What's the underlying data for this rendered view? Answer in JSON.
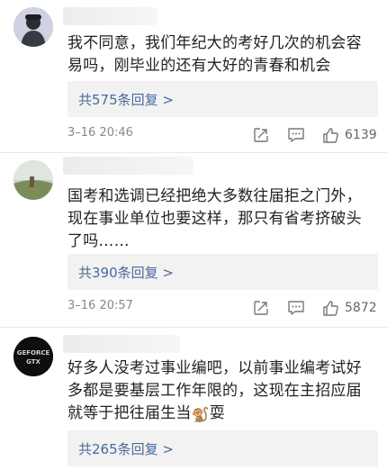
{
  "comments": [
    {
      "text": "我不同意，我们年纪大的考好几次的机会容易吗，刚毕业的还有大好的青春和机会",
      "line1": "我不同意，我们年纪大的考好几次的机会容",
      "line2": "易吗，刚毕业的还有大好的青春和机会",
      "replies": "共575条回复 >",
      "time": "3–16 20:46",
      "likes": "6139"
    },
    {
      "text": "国考和选调已经把绝大多数往届拒之门外，现在事业单位也要这样，那只有省考挤破头了吗……",
      "line1": "国考和选调已经把绝大多数往届拒之门外，",
      "line2": "现在事业单位也要这样，那只有省考挤破头",
      "line3": "了吗……",
      "replies": "共390条回复 >",
      "time": "3–16 20:57",
      "likes": "5872"
    },
    {
      "text": "好多人没考过事业编吧，以前事业编考试好多都是要基层工作年限的，这现在主招应届就等于把往届生当🐒耍",
      "line1": "好多人没考过事业编吧，以前事业编考试好",
      "line2": "多都是要基层工作年限的，这现在主招应届",
      "line3a": "就等于把往届生当",
      "emoji": "🐒",
      "line3b": "耍",
      "replies": "共265条回复 >",
      "avatar_label": "GEFORCE GTX"
    }
  ],
  "icons": [
    "share-icon",
    "comment-icon",
    "like-icon"
  ],
  "colors": {
    "reply_link": "#4a6a99",
    "reply_bg": "#f2f2f2",
    "meta": "#888888"
  }
}
